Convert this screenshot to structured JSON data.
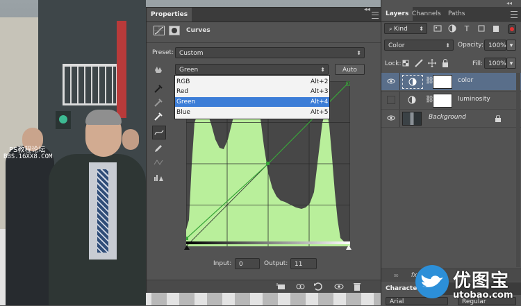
{
  "colors": {
    "panel": "#535353",
    "tabbar": "#3b3b3b",
    "selection": "#3c7dd7",
    "layer_selected": "#596e8a",
    "histogram": "#b9ef9b",
    "curve": "#3aa63a"
  },
  "properties": {
    "tab_label": "Properties",
    "title": "Curves",
    "preset_label": "Preset:",
    "preset_value": "Custom",
    "channel_value": "Green",
    "auto_label": "Auto",
    "input_label": "Input:",
    "input_value": "0",
    "output_label": "Output:",
    "output_value": "11",
    "channel_options": [
      {
        "name": "RGB",
        "shortcut": "Alt+2"
      },
      {
        "name": "Red",
        "shortcut": "Alt+3"
      },
      {
        "name": "Green",
        "shortcut": "Alt+4",
        "selected": true
      },
      {
        "name": "Blue",
        "shortcut": "Alt+5"
      }
    ],
    "tools": [
      "on-image-adjust-icon",
      "eyedropper-black-icon",
      "eyedropper-gray-icon",
      "eyedropper-white-icon",
      "curve-points-icon",
      "pencil-icon",
      "smooth-icon",
      "clipping-warning-icon"
    ],
    "footer_icons": [
      "clip-to-layer-icon",
      "view-previous-icon",
      "reset-icon",
      "visibility-icon",
      "trash-icon"
    ]
  },
  "layers": {
    "tabs": [
      "Layers",
      "Channels",
      "Paths"
    ],
    "filter_kind": "Kind",
    "blend_mode": "Color",
    "opacity_label": "Opacity:",
    "opacity_value": "100%",
    "lock_label": "Lock:",
    "fill_label": "Fill:",
    "fill_value": "100%",
    "items": [
      {
        "name": "color",
        "visible": true,
        "selected": true,
        "type": "adjustment"
      },
      {
        "name": "luminosity",
        "visible": false,
        "selected": false,
        "type": "adjustment"
      },
      {
        "name": "Background",
        "visible": true,
        "selected": false,
        "type": "image",
        "locked": true
      }
    ],
    "character_tab": "Character",
    "font_value": "Arial",
    "style_value": "Regular"
  },
  "watermark": {
    "line1": "PS教程论坛",
    "line2": "BBS.16XX8.COM",
    "logo_text": "优图宝",
    "logo_url": "utobao.com"
  }
}
